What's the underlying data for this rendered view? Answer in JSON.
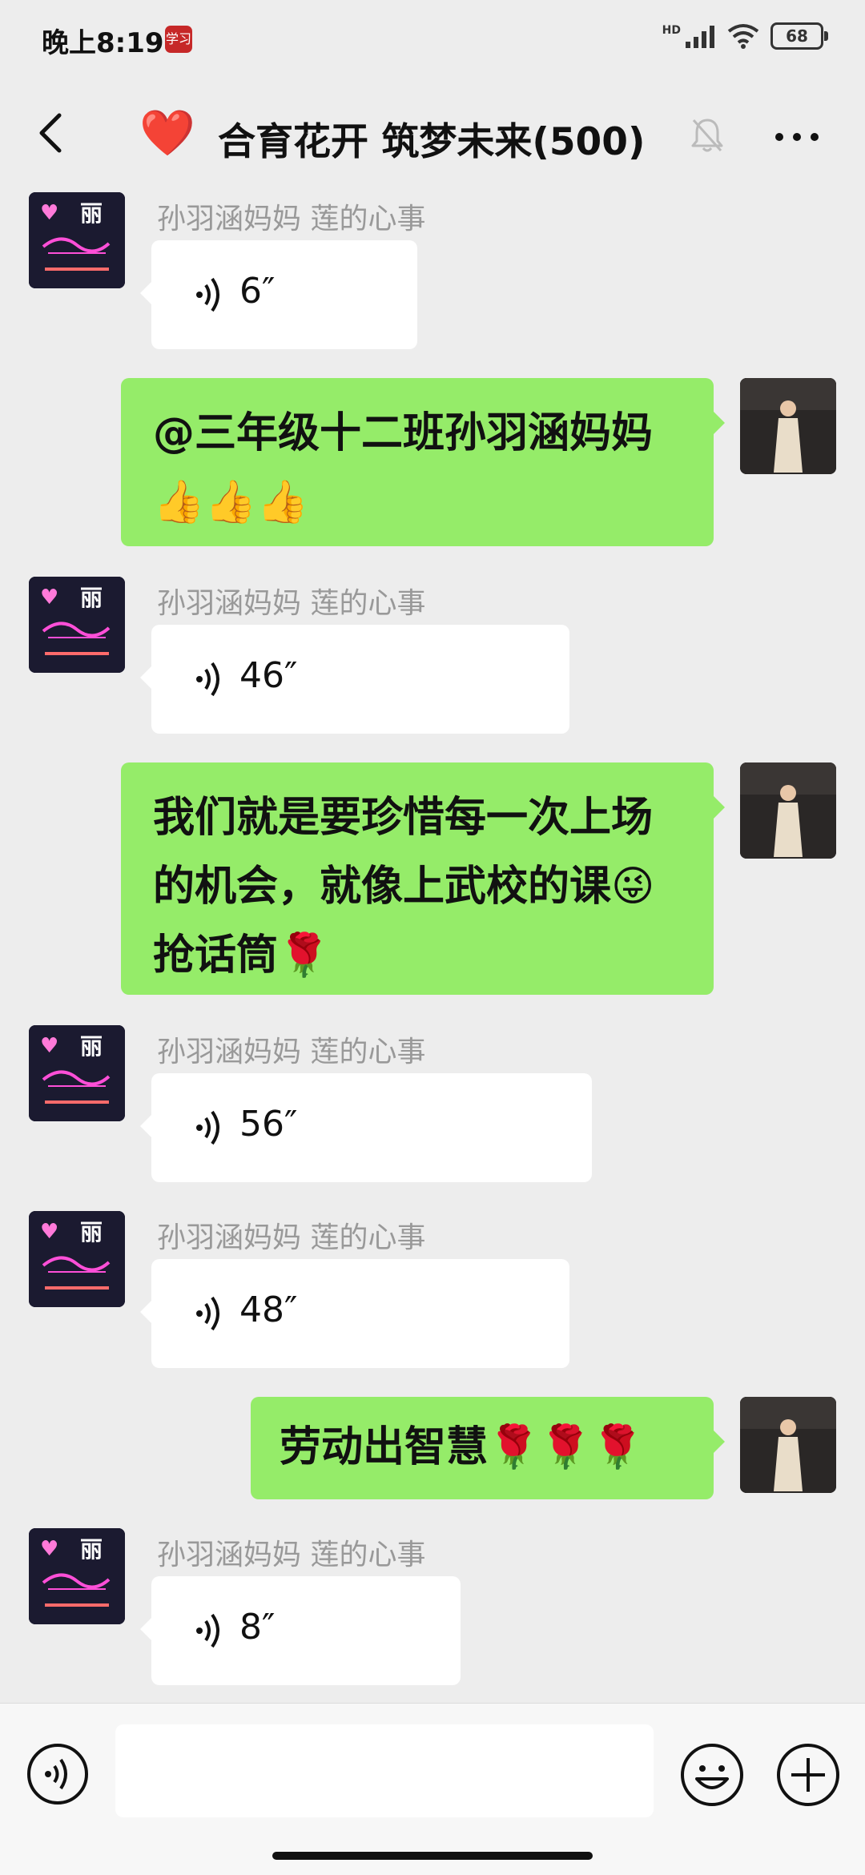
{
  "status_bar": {
    "time": "晚上8:19",
    "app_badge": "学习",
    "network": "HD",
    "battery": "68"
  },
  "header": {
    "heart": "❤️",
    "title": "合育花开 筑梦未来(500)"
  },
  "messages": [
    {
      "type": "voice",
      "side": "left",
      "sender": "孙羽涵妈妈  莲的心事",
      "duration": "6″"
    },
    {
      "type": "text",
      "side": "right",
      "text": "@三年级十二班孙羽涵妈妈 👍👍👍"
    },
    {
      "type": "voice",
      "side": "left",
      "sender": "孙羽涵妈妈  莲的心事",
      "duration": "46″"
    },
    {
      "type": "text",
      "side": "right",
      "text": "我们就是要珍惜每一次上场的机会，就像上武校的课😜抢话筒🌹"
    },
    {
      "type": "voice",
      "side": "left",
      "sender": "孙羽涵妈妈  莲的心事",
      "duration": "56″"
    },
    {
      "type": "voice",
      "side": "left",
      "sender": "孙羽涵妈妈  莲的心事",
      "duration": "48″"
    },
    {
      "type": "text",
      "side": "right",
      "text": "劳动出智慧🌹🌹🌹"
    },
    {
      "type": "voice",
      "side": "left",
      "sender": "孙羽涵妈妈  莲的心事",
      "duration": "8″"
    }
  ],
  "input": {
    "placeholder": ""
  },
  "icons": [
    "back-arrow-icon",
    "mute-bell-icon",
    "more-icon",
    "voice-icon",
    "emoji-icon",
    "plus-icon"
  ],
  "colors": {
    "background": "#ededed",
    "green_bubble": "#95ec69",
    "white_bubble": "#ffffff",
    "sender_name": "#999999"
  }
}
